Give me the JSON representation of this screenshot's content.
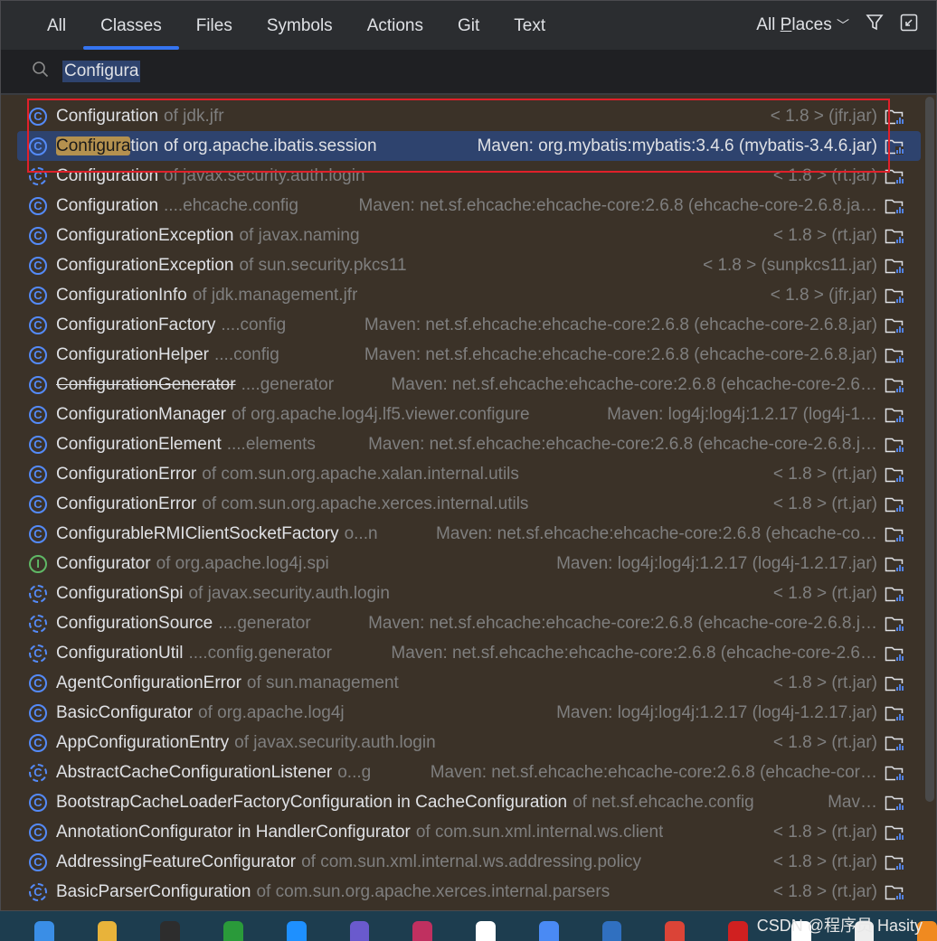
{
  "tabs": [
    {
      "label": "All"
    },
    {
      "label": "Classes",
      "active": true
    },
    {
      "label": "Files"
    },
    {
      "label": "Symbols"
    },
    {
      "label": "Actions"
    },
    {
      "label": "Git"
    },
    {
      "label": "Text"
    }
  ],
  "scope": {
    "label_pre": "All ",
    "label_u": "P",
    "label_post": "laces"
  },
  "search": {
    "value": "Configura"
  },
  "colors": {
    "accent": "#3574f0",
    "selection": "#2e436e",
    "highlight": "#b4914f",
    "list_bg": "#3b3228",
    "annotation_box": "#e0202a"
  },
  "results": [
    {
      "name": "Configuration",
      "ctx": "of jdk.jfr",
      "loc": "< 1.8 > (jfr.jar)",
      "kind": "class"
    },
    {
      "name": "Configuration",
      "ctx": "of org.apache.ibatis.session",
      "loc": "Maven: org.mybatis:mybatis:3.4.6 (mybatis-3.4.6.jar)",
      "kind": "class",
      "selected": true
    },
    {
      "name": "Configuration",
      "ctx": "of javax.security.auth.login",
      "loc": "< 1.8 > (rt.jar)",
      "kind": "abstract"
    },
    {
      "name": "Configuration",
      "ctx": "....ehcache.config",
      "loc": "Maven: net.sf.ehcache:ehcache-core:2.6.8 (ehcache-core-2.6.8.ja…",
      "kind": "class"
    },
    {
      "name": "ConfigurationException",
      "ctx": "of javax.naming",
      "loc": "< 1.8 > (rt.jar)",
      "kind": "class"
    },
    {
      "name": "ConfigurationException",
      "ctx": "of sun.security.pkcs11",
      "loc": "< 1.8 > (sunpkcs11.jar)",
      "kind": "class"
    },
    {
      "name": "ConfigurationInfo",
      "ctx": "of jdk.management.jfr",
      "loc": "< 1.8 > (jfr.jar)",
      "kind": "class"
    },
    {
      "name": "ConfigurationFactory",
      "ctx": "....config",
      "loc": "Maven: net.sf.ehcache:ehcache-core:2.6.8 (ehcache-core-2.6.8.jar)",
      "kind": "class"
    },
    {
      "name": "ConfigurationHelper",
      "ctx": "....config",
      "loc": "Maven: net.sf.ehcache:ehcache-core:2.6.8 (ehcache-core-2.6.8.jar)",
      "kind": "class"
    },
    {
      "name": "ConfigurationGenerator",
      "ctx": "....generator",
      "loc": "Maven: net.sf.ehcache:ehcache-core:2.6.8 (ehcache-core-2.6…",
      "kind": "class",
      "deprecated": true
    },
    {
      "name": "ConfigurationManager",
      "ctx": "of org.apache.log4j.lf5.viewer.configure",
      "loc": "Maven: log4j:log4j:1.2.17 (log4j-1…",
      "kind": "class"
    },
    {
      "name": "ConfigurationElement",
      "ctx": "....elements",
      "loc": "Maven: net.sf.ehcache:ehcache-core:2.6.8 (ehcache-core-2.6.8.j…",
      "kind": "class"
    },
    {
      "name": "ConfigurationError",
      "ctx": "of com.sun.org.apache.xalan.internal.utils",
      "loc": "< 1.8 > (rt.jar)",
      "kind": "class"
    },
    {
      "name": "ConfigurationError",
      "ctx": "of com.sun.org.apache.xerces.internal.utils",
      "loc": "< 1.8 > (rt.jar)",
      "kind": "class"
    },
    {
      "name": "ConfigurableRMIClientSocketFactory",
      "ctx": "o...n",
      "loc": "Maven: net.sf.ehcache:ehcache-core:2.6.8 (ehcache-co…",
      "kind": "class"
    },
    {
      "name": "Configurator",
      "ctx": "of org.apache.log4j.spi",
      "loc": "Maven: log4j:log4j:1.2.17 (log4j-1.2.17.jar)",
      "kind": "interface"
    },
    {
      "name": "ConfigurationSpi",
      "ctx": "of javax.security.auth.login",
      "loc": "< 1.8 > (rt.jar)",
      "kind": "abstract"
    },
    {
      "name": "ConfigurationSource",
      "ctx": "....generator",
      "loc": "Maven: net.sf.ehcache:ehcache-core:2.6.8 (ehcache-core-2.6.8.j…",
      "kind": "abstract"
    },
    {
      "name": "ConfigurationUtil",
      "ctx": "....config.generator",
      "loc": "Maven: net.sf.ehcache:ehcache-core:2.6.8 (ehcache-core-2.6…",
      "kind": "abstract"
    },
    {
      "name": "AgentConfigurationError",
      "ctx": "of sun.management",
      "loc": "< 1.8 > (rt.jar)",
      "kind": "class"
    },
    {
      "name": "BasicConfigurator",
      "ctx": "of org.apache.log4j",
      "loc": "Maven: log4j:log4j:1.2.17 (log4j-1.2.17.jar)",
      "kind": "class"
    },
    {
      "name": "AppConfigurationEntry",
      "ctx": "of javax.security.auth.login",
      "loc": "< 1.8 > (rt.jar)",
      "kind": "class"
    },
    {
      "name": "AbstractCacheConfigurationListener",
      "ctx": "o...g",
      "loc": "Maven: net.sf.ehcache:ehcache-core:2.6.8 (ehcache-cor…",
      "kind": "abstract"
    },
    {
      "name": "BootstrapCacheLoaderFactoryConfiguration in CacheConfiguration",
      "ctx": "of net.sf.ehcache.config",
      "loc": "Mav…",
      "kind": "class"
    },
    {
      "name": "AnnotationConfigurator in HandlerConfigurator",
      "ctx": "of com.sun.xml.internal.ws.client",
      "loc": "< 1.8 > (rt.jar)",
      "kind": "class"
    },
    {
      "name": "AddressingFeatureConfigurator",
      "ctx": "of com.sun.xml.internal.ws.addressing.policy",
      "loc": "< 1.8 > (rt.jar)",
      "kind": "class"
    },
    {
      "name": "BasicParserConfiguration",
      "ctx": "of com.sun.org.apache.xerces.internal.parsers",
      "loc": "< 1.8 > (rt.jar)",
      "kind": "abstract"
    }
  ],
  "watermark": "CSDN @程序员 Hasity",
  "taskbar_icons": [
    "file-explorer",
    "app",
    "app",
    "translate",
    "app",
    "intellij",
    "qq",
    "app",
    "app",
    "chrome",
    "app",
    "app",
    "typora",
    "app",
    "app"
  ]
}
